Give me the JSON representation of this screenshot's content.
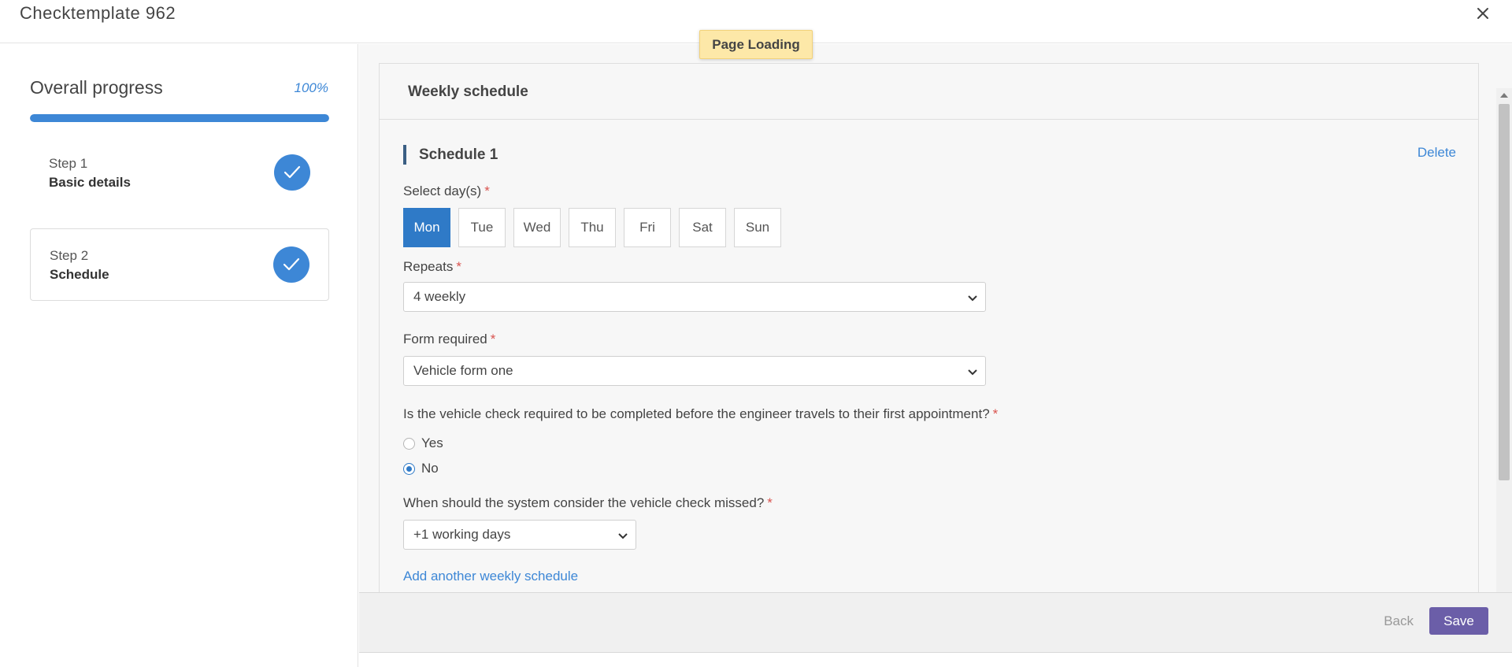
{
  "header": {
    "title": "Checktemplate 962",
    "close_icon": "close-icon"
  },
  "loading_badge": "Page Loading",
  "sidebar": {
    "progress_label": "Overall progress",
    "progress_pct": "100%",
    "progress_value": 1.0,
    "steps": [
      {
        "number": "Step 1",
        "name": "Basic details",
        "status_icon": "check-icon"
      },
      {
        "number": "Step 2",
        "name": "Schedule",
        "status_icon": "check-icon"
      }
    ]
  },
  "main": {
    "panel_title": "Weekly schedule",
    "schedule_title": "Schedule 1",
    "delete_label": "Delete",
    "days_label": "Select day(s)",
    "days": [
      {
        "label": "Mon",
        "selected": true
      },
      {
        "label": "Tue",
        "selected": false
      },
      {
        "label": "Wed",
        "selected": false
      },
      {
        "label": "Thu",
        "selected": false
      },
      {
        "label": "Fri",
        "selected": false
      },
      {
        "label": "Sat",
        "selected": false
      },
      {
        "label": "Sun",
        "selected": false
      }
    ],
    "repeats_label": "Repeats",
    "repeats_value": "4 weekly",
    "form_label": "Form required",
    "form_value": "Vehicle form one",
    "travel_question": "Is the vehicle check required to be completed before the engineer travels to their first appointment?",
    "travel_options": [
      {
        "label": "Yes",
        "checked": false
      },
      {
        "label": "No",
        "checked": true
      }
    ],
    "missed_question": "When should the system consider the vehicle check missed?",
    "missed_value": "+1 working days",
    "add_link": "Add another weekly schedule",
    "required_mark": "*"
  },
  "footer": {
    "back_label": "Back",
    "save_label": "Save"
  },
  "colors": {
    "accent": "#3d87d6",
    "selected_day": "#2f7ac7",
    "save": "#6b5ea8",
    "required": "#d9534f",
    "loading_bg": "#fde8a8"
  }
}
